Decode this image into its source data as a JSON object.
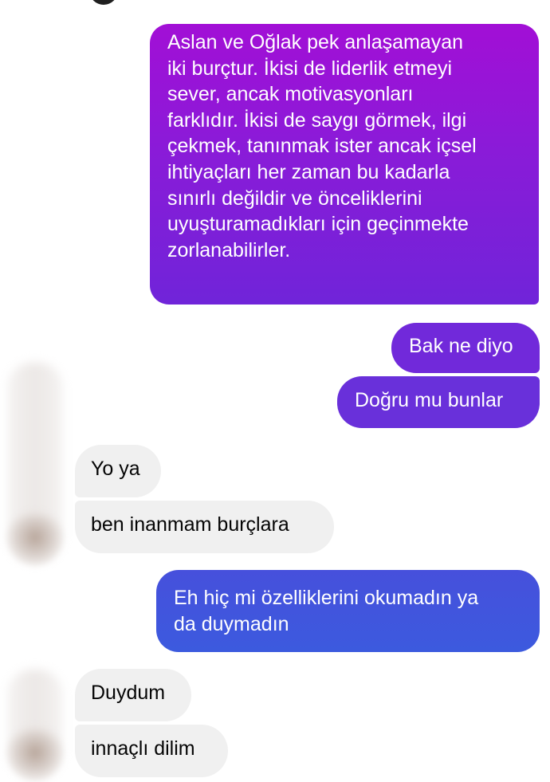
{
  "conversation": {
    "messages": [
      {
        "sender": "me",
        "lines": [
          "Aslan ve Oğlak pek anlaşamayan",
          "iki burçtur. İkisi de liderlik etmeyi",
          "sever, ancak motivasyonları",
          "farklıdır. İkisi de saygı görmek, ilgi",
          "çekmek, tanınmak ister ancak içsel",
          "ihtiyaçları her zaman bu kadarla",
          "sınırlı değildir ve önceliklerini",
          "uyuşturamadıkları için geçinmekte",
          "zorlanabilirler."
        ]
      },
      {
        "sender": "me",
        "text": "Bak ne diyo"
      },
      {
        "sender": "me",
        "text": "Doğru mu bunlar"
      },
      {
        "sender": "them",
        "text": "Yo ya"
      },
      {
        "sender": "them",
        "text": "ben inanmam burçlara"
      },
      {
        "sender": "me",
        "lines": [
          "Eh hiç mi özelliklerini okumadın ya",
          "da duymadın"
        ]
      },
      {
        "sender": "them",
        "text": "Duydum"
      },
      {
        "sender": "them",
        "text": "innaçlı dilim"
      }
    ]
  },
  "colors": {
    "sent_top": "#a10fd6",
    "sent_mid": "#6a2bd9",
    "sent_bottom": "#3f55dd",
    "received": "#f0f0f0"
  }
}
